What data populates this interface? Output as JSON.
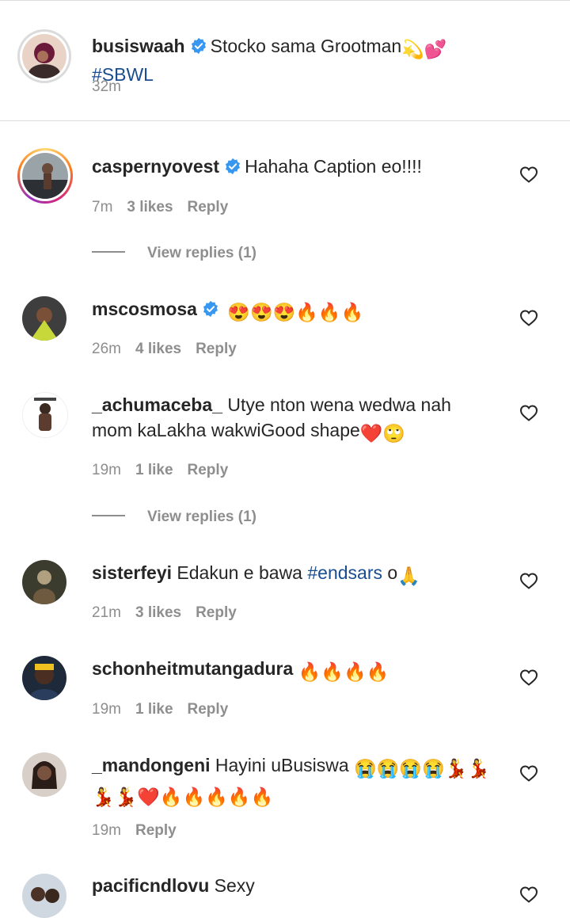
{
  "caption": {
    "username": "busiswaah",
    "verified": true,
    "text": "Stocko sama Grootman",
    "hashtag": "#SBWL",
    "time": "32m"
  },
  "comments": [
    {
      "username": "caspernyovest",
      "verified": true,
      "text": "Hahaha Caption eo!!!!",
      "time": "7m",
      "likes": "3 likes",
      "reply": "Reply",
      "view_replies": "View replies (1)"
    },
    {
      "username": "mscosmosa",
      "verified": true,
      "text": "",
      "emojis": "😍😍😍🔥🔥🔥",
      "time": "26m",
      "likes": "4 likes",
      "reply": "Reply"
    },
    {
      "username": "_achumaceba_",
      "verified": false,
      "text": "Utye nton wena wedwa nah",
      "text2": "mom kaLakha wakwiGood shape",
      "time": "19m",
      "likes": "1 like",
      "reply": "Reply",
      "view_replies": "View replies (1)"
    },
    {
      "username": "sisterfeyi",
      "verified": false,
      "text": "Edakun e bawa",
      "hashtag": "#endsars",
      "text_after": "o",
      "time": "21m",
      "likes": "3 likes",
      "reply": "Reply"
    },
    {
      "username": "schonheitmutangadura",
      "verified": false,
      "text": "",
      "emojis": "🔥🔥🔥🔥",
      "time": "19m",
      "likes": "1 like",
      "reply": "Reply"
    },
    {
      "username": "_mandongeni",
      "verified": false,
      "text": "Hayini uBusiswa",
      "emojis": "😭😭😭😭💃💃",
      "emojis2": "💃💃❤️🔥🔥🔥🔥🔥",
      "time": "19m",
      "reply": "Reply"
    },
    {
      "username": "pacificndlovu",
      "verified": false,
      "text": "Sexy"
    }
  ],
  "icons": {
    "verified": "verified-badge-icon",
    "heart": "heart-outline-icon"
  },
  "colors": {
    "verified": "#3897f0",
    "hashtag": "#1a4d8f",
    "meta": "#8e8e8e"
  }
}
